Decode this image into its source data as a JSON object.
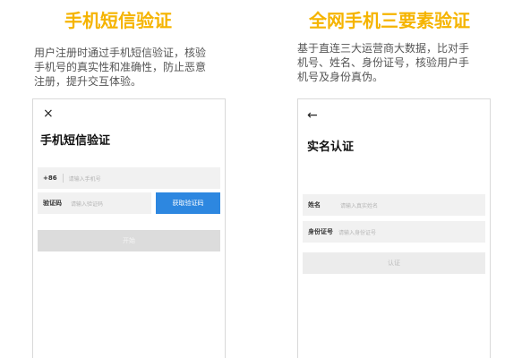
{
  "left": {
    "heading": "手机短信验证",
    "description_lines": [
      "用户注册时通过手机短信验证，核验",
      "手机号的真实性和准确性，防止恶意",
      "注册，提升交互体验。"
    ],
    "screen": {
      "close_icon": "×",
      "title": "手机短信验证",
      "phone_prefix": "+86",
      "phone_placeholder": "请输入手机号",
      "code_label": "验证码",
      "code_placeholder": "请输入验证码",
      "get_code_button": "获取验证码",
      "start_button": "开始"
    }
  },
  "right": {
    "heading": "全网手机三要素验证",
    "description_lines": [
      "基于直连三大运营商大数据，比对手",
      "机号、姓名、身份证号，核验用户手",
      "机号及身份真伪。"
    ],
    "screen": {
      "back_icon": "←",
      "title": "实名认证",
      "name_label": "姓名",
      "name_placeholder": "请输入真实姓名",
      "id_label": "身份证号",
      "id_placeholder": "请输入身份证号",
      "verify_button": "认证"
    }
  },
  "colors": {
    "heading": "#f5b400",
    "primary_button": "#2d87e0",
    "disabled_button": "#dcdcdc",
    "field_bg": "#f1f1f1"
  }
}
